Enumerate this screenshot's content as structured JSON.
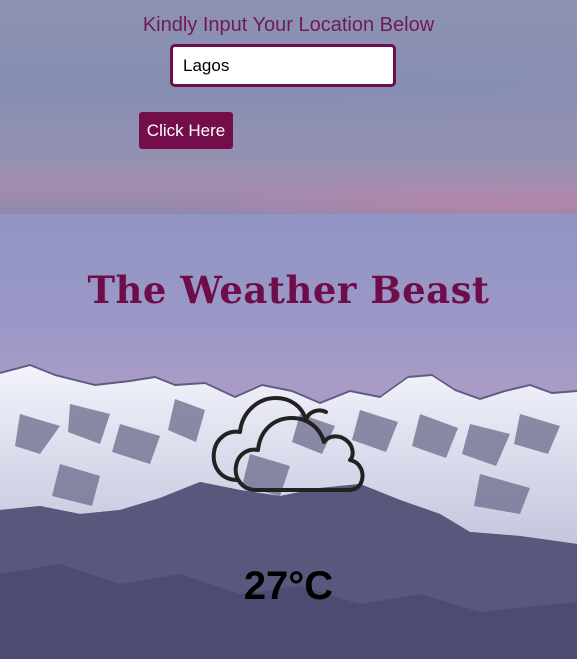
{
  "form": {
    "prompt": "Kindly Input Your Location Below",
    "location_value": "Lagos",
    "submit_label": "Click Here"
  },
  "weather": {
    "app_title": "The Weather Beast",
    "condition_icon": "cloud-icon",
    "temperature": "27°C"
  },
  "colors": {
    "brand": "#730e4b",
    "sky": "#9a98c6",
    "text_dark": "#000000"
  }
}
